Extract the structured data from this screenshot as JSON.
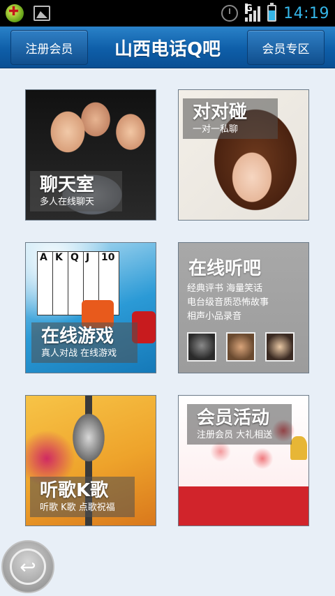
{
  "status_bar": {
    "time": "14:19",
    "icons": [
      "app-notification-icon",
      "gallery-icon",
      "alarm-icon",
      "signal-icon",
      "battery-icon"
    ],
    "signal_letter": "G"
  },
  "header": {
    "title": "山西电话Q吧",
    "left_button": "注册会员",
    "right_button": "会员专区",
    "colors": {
      "bar": "#1565b0",
      "button": "#1f6fb8"
    }
  },
  "tiles": [
    {
      "title": "聊天室",
      "subtitle": "多人在线聊天"
    },
    {
      "title": "对对碰",
      "subtitle": "一对一私聊"
    },
    {
      "title": "在线游戏",
      "subtitle": "真人对战 在线游戏"
    },
    {
      "title": "在线听吧",
      "lines": [
        "经典评书 海量笑话",
        "电台级音质恐怖故事",
        "相声小品录音"
      ]
    },
    {
      "title": "听歌K歌",
      "subtitle": "听歌 K歌 点歌祝福"
    },
    {
      "title": "会员活动",
      "subtitle": "注册会员 大礼相送"
    }
  ],
  "cards": [
    "A",
    "K",
    "Q",
    "J",
    "10"
  ],
  "back_button": {
    "icon": "back-arrow-icon"
  },
  "colors": {
    "page_bg": "#e8eff7",
    "time": "#35b6e8"
  }
}
